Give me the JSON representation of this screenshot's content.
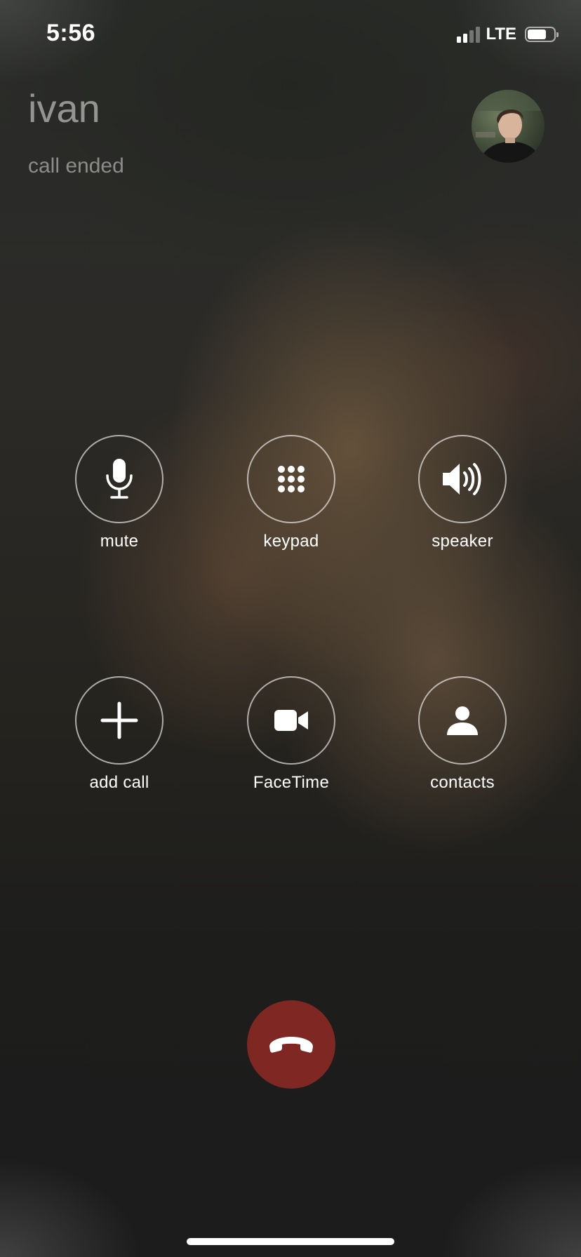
{
  "status_bar": {
    "time": "5:56",
    "network": "LTE",
    "signal_bars_filled": 2,
    "signal_bars_total": 4,
    "battery_level": 0.7
  },
  "call": {
    "caller_name": "ivan",
    "status": "call ended",
    "avatar_icon": "contact-photo"
  },
  "controls": [
    {
      "label": "mute",
      "icon": "microphone-icon"
    },
    {
      "label": "keypad",
      "icon": "keypad-icon"
    },
    {
      "label": "speaker",
      "icon": "speaker-icon"
    },
    {
      "label": "add call",
      "icon": "plus-icon"
    },
    {
      "label": "FaceTime",
      "icon": "video-camera-icon"
    },
    {
      "label": "contacts",
      "icon": "person-icon"
    }
  ],
  "end_call": {
    "icon": "phone-hangup-icon",
    "color": "#7e2723"
  },
  "colors": {
    "control_border": "#ffffff",
    "text": "#ffffff",
    "end_call": "#7e2723"
  }
}
